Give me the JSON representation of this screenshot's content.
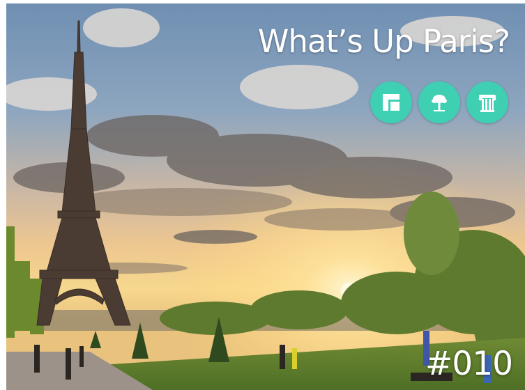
{
  "header": {
    "title": "What’s Up Paris?"
  },
  "icons": [
    {
      "name": "tile-icon",
      "bg": "#3fd0b4"
    },
    {
      "name": "tree-icon",
      "bg": "#3fd0b4"
    },
    {
      "name": "column-icon",
      "bg": "#3fd0b4"
    }
  ],
  "issue": {
    "number": "#010"
  },
  "colors": {
    "accent": "#3fd0b4",
    "text": "#ffffff"
  }
}
